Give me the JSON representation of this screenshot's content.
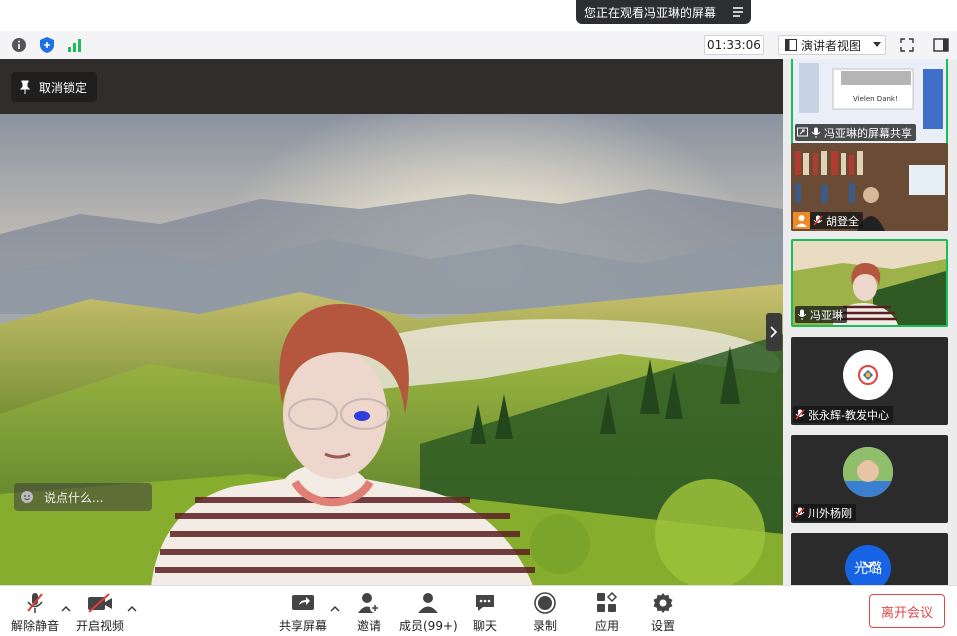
{
  "banner": {
    "text": "您正在观看冯亚琳的屏幕"
  },
  "topbar": {
    "timer": "01:33:06",
    "view_mode": "演讲者视图"
  },
  "stage": {
    "unlock_label": "取消锁定",
    "chat_placeholder": "说点什么..."
  },
  "participants": [
    {
      "name": "冯亚琳的屏幕共享"
    },
    {
      "name": "胡登全"
    },
    {
      "name": "冯亚琳"
    },
    {
      "name": "张永辉-教发中心"
    },
    {
      "name": "川外杨刚"
    },
    {
      "name": "光璐"
    }
  ],
  "share_thumb": {
    "slide_text": "Vielen Dank!"
  },
  "toolbar": {
    "unmute": "解除静音",
    "start_video": "开启视频",
    "share_screen": "共享屏幕",
    "invite": "邀请",
    "members": "成员(99+)",
    "chat": "聊天",
    "record": "录制",
    "apps": "应用",
    "settings": "设置",
    "leave": "离开会议"
  },
  "colors": {
    "accent_green": "#1bbd5a",
    "leave_red": "#e04848",
    "shield_blue": "#1f6fe5"
  }
}
